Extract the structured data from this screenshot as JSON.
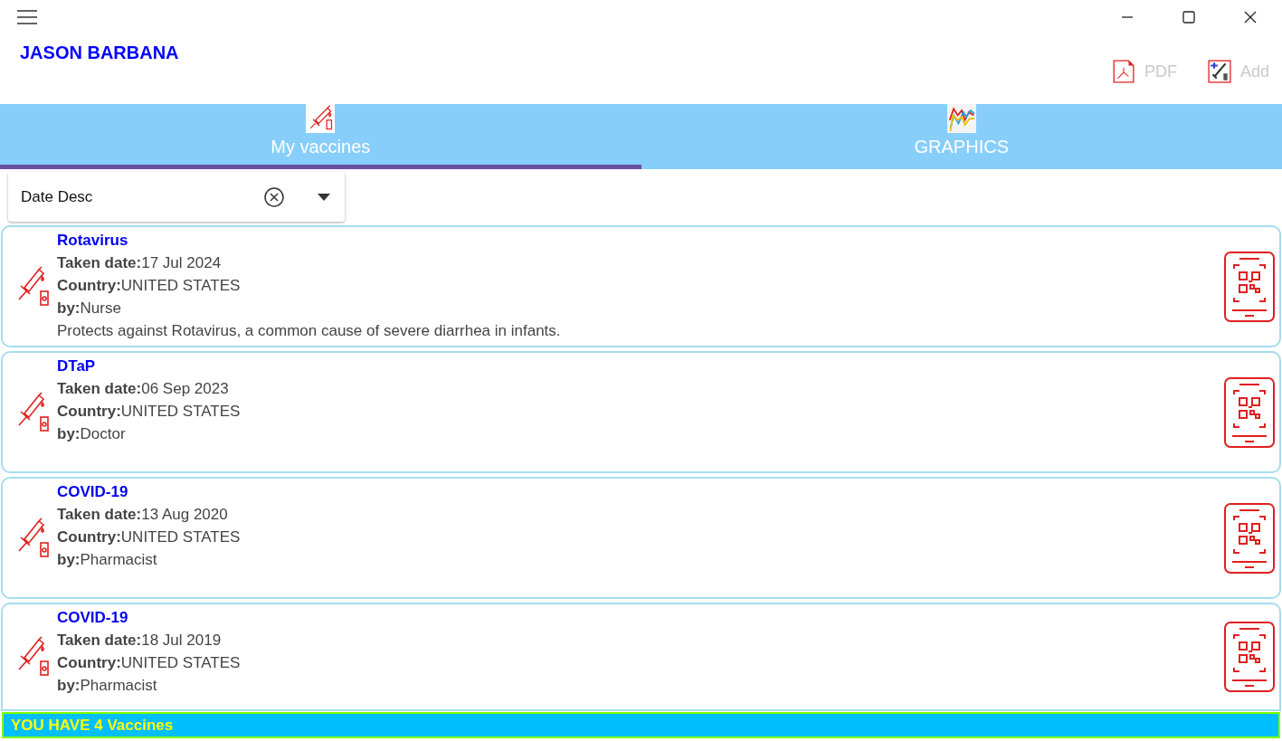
{
  "user": {
    "name": "JASON BARBANA"
  },
  "toolbar": [
    {
      "label": "PDF",
      "kind": "pdf",
      "disabled": true
    },
    {
      "label": "Add",
      "kind": "add",
      "disabled": true
    }
  ],
  "tabs": [
    {
      "label": "My vaccines",
      "kind": "vaccine",
      "selected": true
    },
    {
      "label": "GRAPHICS",
      "kind": "chart",
      "selected": false
    }
  ],
  "sort": {
    "value": "Date Desc"
  },
  "vaccines": [
    {
      "name": "Rotavirus",
      "lines": [
        "**Taken date:**17 Jul 2024",
        "**Country:**UNITED STATES",
        "**by:**Nurse"
      ],
      "description": "Protects against Rotavirus, a common cause of severe diarrhea in infants."
    },
    {
      "name": "DTaP",
      "lines": [
        "**Taken date:**06 Sep 2023",
        "**Country:**UNITED STATES",
        "**by:**Doctor"
      ]
    },
    {
      "name": "COVID-19",
      "lines": [
        "**Taken date:**13 Aug 2020",
        "**Country:**UNITED STATES",
        "**by:**Pharmacist"
      ]
    },
    {
      "name": "COVID-19",
      "lines": [
        "**Taken date:**18 Jul 2019",
        "**Country:**UNITED STATES",
        "**by:**Pharmacist"
      ]
    }
  ],
  "banner": {
    "text": "YOU HAVE 4 Vaccines"
  }
}
